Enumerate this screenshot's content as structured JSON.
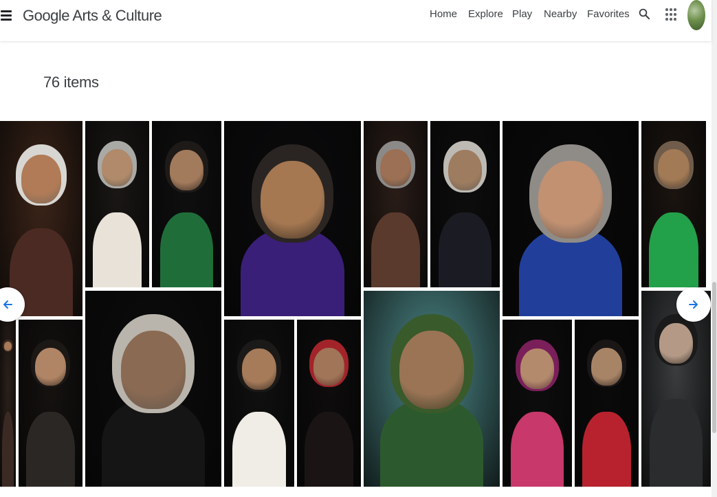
{
  "header": {
    "logo": "Google Arts & Culture",
    "nav": [
      "Home",
      "Explore",
      "Play",
      "Nearby",
      "Favorites"
    ]
  },
  "gallery": {
    "count": "76 items",
    "tiles": [
      {
        "bg": "#3b2418",
        "skin": "#b07b56",
        "hair": "#d8d6d2",
        "cloth": "#4a2a22"
      },
      {
        "bg": "#1a1715",
        "skin": "#b08a6a",
        "hair": "#a9a9a6",
        "cloth": "#e8e2d8"
      },
      {
        "bg": "#0f0f0f",
        "skin": "#a27a5c",
        "hair": "#1e1a18",
        "cloth": "#1f6e3a"
      },
      {
        "bg": "#0b0b0d",
        "skin": "#a57852",
        "hair": "#2a2522",
        "cloth": "#3a1f78"
      },
      {
        "bg": "#2a1d18",
        "skin": "#9c7054",
        "hair": "#8c8a88",
        "cloth": "#5a3a2c"
      },
      {
        "bg": "#0d0d0d",
        "skin": "#9e7c60",
        "hair": "#bdbab4",
        "cloth": "#1b1b24"
      },
      {
        "bg": "#090909",
        "skin": "#c19172",
        "hair": "#8f8c88",
        "cloth": "#213f9a"
      },
      {
        "bg": "#1b1410",
        "skin": "#a27a56",
        "hair": "#6f5c4a",
        "cloth": "#23a04a"
      },
      {
        "bg": "#2b201a",
        "skin": "#a77a5a",
        "hair": "#3a2a22",
        "cloth": "#3b2a24"
      },
      {
        "bg": "#151210",
        "skin": "#b08566",
        "hair": "#1c1816",
        "cloth": "#2b2724"
      },
      {
        "bg": "#0c0c0c",
        "skin": "#8a6a52",
        "hair": "#b9b4ac",
        "cloth": "#151515"
      },
      {
        "bg": "#111010",
        "skin": "#a67b5a",
        "hair": "#1c1a18",
        "cloth": "#f0ece6"
      },
      {
        "bg": "#0e0c0c",
        "skin": "#a07558",
        "hair": "#a2242a",
        "cloth": "#1a1414"
      },
      {
        "bg": "#4e8a8a",
        "skin": "#9a7455",
        "hair": "#395a2a",
        "cloth": "#2c5a2e"
      },
      {
        "bg": "#0d0d0d",
        "skin": "#b48a6c",
        "hair": "#7a1f5a",
        "cloth": "#c8386a"
      },
      {
        "bg": "#0a0a0a",
        "skin": "#a88466",
        "hair": "#1a1616",
        "cloth": "#b8222e"
      },
      {
        "bg": "#3a3c3e",
        "skin": "#b49a86",
        "hair": "#1a1a1a",
        "cloth": "#2a2c2e"
      }
    ]
  }
}
